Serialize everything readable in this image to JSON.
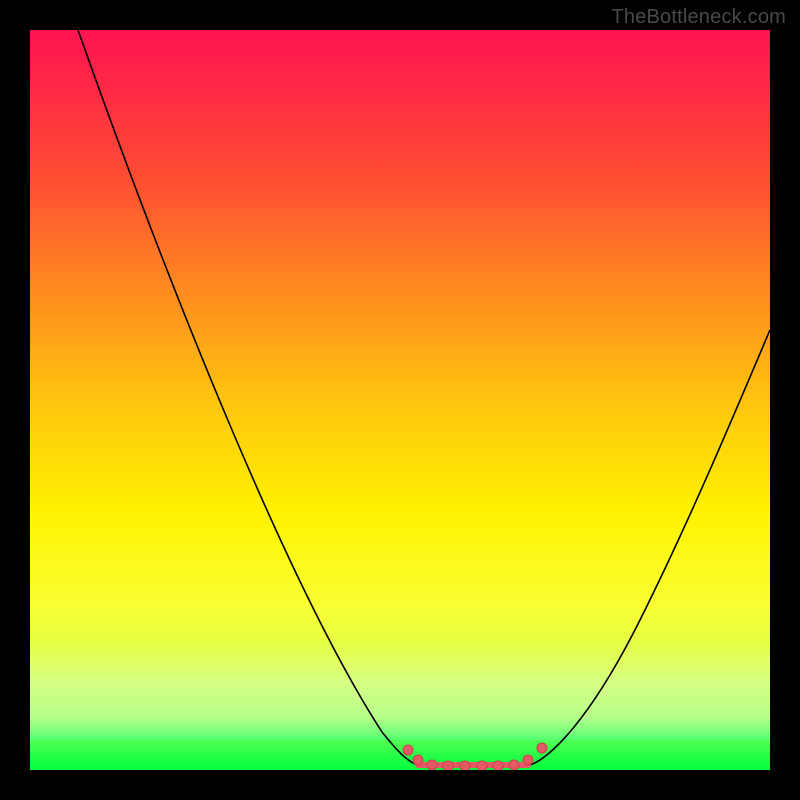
{
  "watermark": "TheBottleneck.com",
  "chart_data": {
    "type": "line",
    "title": "",
    "xlabel": "",
    "ylabel": "",
    "xlim": [
      0,
      100
    ],
    "ylim": [
      0,
      100
    ],
    "background_gradient": {
      "orientation": "vertical",
      "stops": [
        {
          "pos": 0,
          "color": "#ff1450"
        },
        {
          "pos": 20,
          "color": "#ff4d33"
        },
        {
          "pos": 50,
          "color": "#ffc40f"
        },
        {
          "pos": 70,
          "color": "#fff200"
        },
        {
          "pos": 90,
          "color": "#8cff66"
        },
        {
          "pos": 100,
          "color": "#00ff3c"
        }
      ]
    },
    "series": [
      {
        "name": "left_curve",
        "style": "line",
        "color": "#000000",
        "x": [
          6,
          15,
          25,
          35,
          45,
          52
        ],
        "y": [
          100,
          70,
          42,
          20,
          6,
          1
        ]
      },
      {
        "name": "right_curve",
        "style": "line",
        "color": "#000000",
        "x": [
          68,
          75,
          83,
          92,
          100
        ],
        "y": [
          1,
          8,
          20,
          40,
          60
        ]
      },
      {
        "name": "bottom_markers",
        "style": "markers",
        "color": "#e45a64",
        "x": [
          51,
          53,
          55,
          57,
          59,
          61,
          63,
          65,
          67,
          69
        ],
        "y": [
          3,
          1.5,
          0.7,
          0.5,
          0.5,
          0.5,
          0.5,
          0.7,
          1.5,
          3
        ]
      }
    ]
  }
}
